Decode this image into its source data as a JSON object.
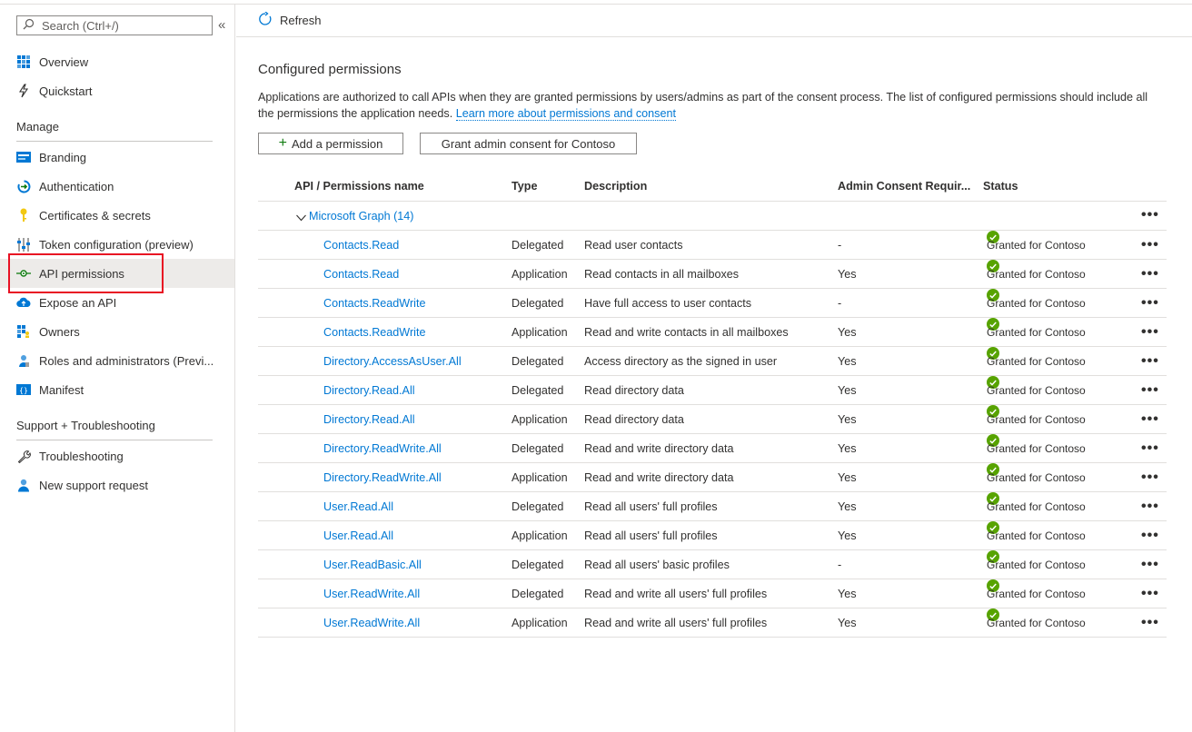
{
  "search": {
    "placeholder": "Search (Ctrl+/)"
  },
  "sidebar": {
    "collapse_glyph": "«",
    "items_top": [
      {
        "label": "Overview",
        "icon": "grid-icon"
      },
      {
        "label": "Quickstart",
        "icon": "lightning-icon"
      }
    ],
    "manage_header": "Manage",
    "manage_items": [
      {
        "label": "Branding",
        "icon": "branding-icon"
      },
      {
        "label": "Authentication",
        "icon": "authentication-icon"
      },
      {
        "label": "Certificates & secrets",
        "icon": "key-icon"
      },
      {
        "label": "Token configuration (preview)",
        "icon": "sliders-icon"
      },
      {
        "label": "API permissions",
        "icon": "api-icon",
        "active": true
      },
      {
        "label": "Expose an API",
        "icon": "cloud-icon"
      },
      {
        "label": "Owners",
        "icon": "owners-icon"
      },
      {
        "label": "Roles and administrators (Previ...",
        "icon": "user-badge-icon"
      },
      {
        "label": "Manifest",
        "icon": "manifest-icon"
      }
    ],
    "support_header": "Support + Troubleshooting",
    "support_items": [
      {
        "label": "Troubleshooting",
        "icon": "wrench-icon"
      },
      {
        "label": "New support request",
        "icon": "person-icon"
      }
    ]
  },
  "toolbar": {
    "refresh_label": "Refresh"
  },
  "main": {
    "title": "Configured permissions",
    "description": "Applications are authorized to call APIs when they are granted permissions by users/admins as part of the consent process. The list of configured permissions should include all the permissions the application needs.",
    "learn_more": "Learn more about permissions and consent",
    "add_permission_label": "Add a permission",
    "grant_consent_label": "Grant admin consent for Contoso"
  },
  "table": {
    "headers": [
      "API / Permissions name",
      "Type",
      "Description",
      "Admin Consent Requir...",
      "Status"
    ],
    "group_label": "Microsoft Graph (14)",
    "more_glyph": "•••",
    "rows": [
      {
        "name": "Contacts.Read",
        "type": "Delegated",
        "description": "Read user contacts",
        "admin": "-",
        "status": "Granted for Contoso"
      },
      {
        "name": "Contacts.Read",
        "type": "Application",
        "description": "Read contacts in all mailboxes",
        "admin": "Yes",
        "status": "Granted for Contoso"
      },
      {
        "name": "Contacts.ReadWrite",
        "type": "Delegated",
        "description": "Have full access to user contacts",
        "admin": "-",
        "status": "Granted for Contoso"
      },
      {
        "name": "Contacts.ReadWrite",
        "type": "Application",
        "description": "Read and write contacts in all mailboxes",
        "admin": "Yes",
        "status": "Granted for Contoso"
      },
      {
        "name": "Directory.AccessAsUser.All",
        "type": "Delegated",
        "description": "Access directory as the signed in user",
        "admin": "Yes",
        "status": "Granted for Contoso"
      },
      {
        "name": "Directory.Read.All",
        "type": "Delegated",
        "description": "Read directory data",
        "admin": "Yes",
        "status": "Granted for Contoso"
      },
      {
        "name": "Directory.Read.All",
        "type": "Application",
        "description": "Read directory data",
        "admin": "Yes",
        "status": "Granted for Contoso"
      },
      {
        "name": "Directory.ReadWrite.All",
        "type": "Delegated",
        "description": "Read and write directory data",
        "admin": "Yes",
        "status": "Granted for Contoso"
      },
      {
        "name": "Directory.ReadWrite.All",
        "type": "Application",
        "description": "Read and write directory data",
        "admin": "Yes",
        "status": "Granted for Contoso"
      },
      {
        "name": "User.Read.All",
        "type": "Delegated",
        "description": "Read all users' full profiles",
        "admin": "Yes",
        "status": "Granted for Contoso"
      },
      {
        "name": "User.Read.All",
        "type": "Application",
        "description": "Read all users' full profiles",
        "admin": "Yes",
        "status": "Granted for Contoso"
      },
      {
        "name": "User.ReadBasic.All",
        "type": "Delegated",
        "description": "Read all users' basic profiles",
        "admin": "-",
        "status": "Granted for Contoso"
      },
      {
        "name": "User.ReadWrite.All",
        "type": "Delegated",
        "description": "Read and write all users' full profiles",
        "admin": "Yes",
        "status": "Granted for Contoso"
      },
      {
        "name": "User.ReadWrite.All",
        "type": "Application",
        "description": "Read and write all users' full profiles",
        "admin": "Yes",
        "status": "Granted for Contoso"
      }
    ]
  },
  "colors": {
    "accent": "#0078d4",
    "granted": "#57a300",
    "highlight": "#e81123"
  }
}
